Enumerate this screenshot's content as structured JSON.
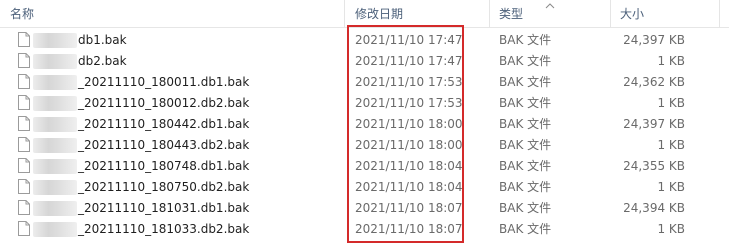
{
  "header": {
    "name": "名称",
    "date_modified": "修改日期",
    "type": "类型",
    "size": "大小"
  },
  "files": [
    {
      "name": "db1.bak",
      "date": "2021/11/10 17:47",
      "type": "BAK 文件",
      "size": "24,397 KB"
    },
    {
      "name": "db2.bak",
      "date": "2021/11/10 17:47",
      "type": "BAK 文件",
      "size": "1 KB"
    },
    {
      "name": "_20211110_180011.db1.bak",
      "date": "2021/11/10 17:53",
      "type": "BAK 文件",
      "size": "24,362 KB"
    },
    {
      "name": "_20211110_180012.db2.bak",
      "date": "2021/11/10 17:53",
      "type": "BAK 文件",
      "size": "1 KB"
    },
    {
      "name": "_20211110_180442.db1.bak",
      "date": "2021/11/10 18:00",
      "type": "BAK 文件",
      "size": "24,397 KB"
    },
    {
      "name": "_20211110_180443.db2.bak",
      "date": "2021/11/10 18:00",
      "type": "BAK 文件",
      "size": "1 KB"
    },
    {
      "name": "_20211110_180748.db1.bak",
      "date": "2021/11/10 18:04",
      "type": "BAK 文件",
      "size": "24,355 KB"
    },
    {
      "name": "_20211110_180750.db2.bak",
      "date": "2021/11/10 18:04",
      "type": "BAK 文件",
      "size": "1 KB"
    },
    {
      "name": "_20211110_181031.db1.bak",
      "date": "2021/11/10 18:07",
      "type": "BAK 文件",
      "size": "24,394 KB"
    },
    {
      "name": "_20211110_181033.db2.bak",
      "date": "2021/11/10 18:07",
      "type": "BAK 文件",
      "size": "1 KB"
    }
  ],
  "colors": {
    "highlight_border": "#d42a2a",
    "header_text": "#4c607a"
  },
  "icons": {
    "file": "file-icon",
    "sort": "sort-caret-icon"
  }
}
